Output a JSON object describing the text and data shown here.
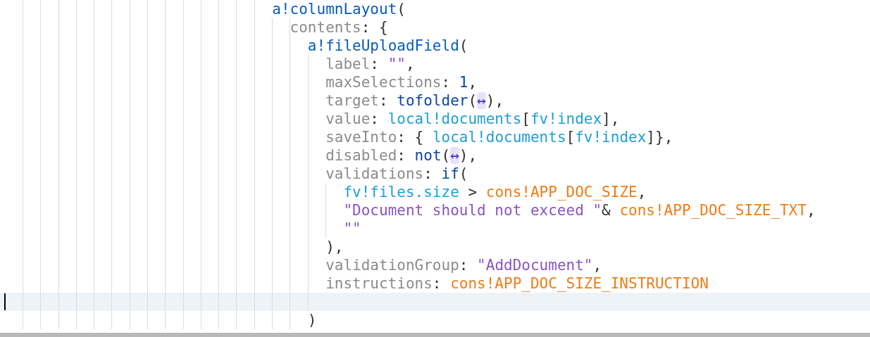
{
  "editor": {
    "lines": [
      {
        "current": false,
        "tokens": [
          {
            "text": "a!columnLayout",
            "kind": "function"
          },
          {
            "text": "(",
            "kind": "punct"
          }
        ],
        "children": [
          {
            "current": false,
            "tokens": [
              {
                "text": "contents",
                "kind": "property"
              },
              {
                "text": ": {",
                "kind": "punct"
              }
            ],
            "children": [
              {
                "current": false,
                "tokens": [
                  {
                    "text": "a!fileUploadField",
                    "kind": "function"
                  },
                  {
                    "text": "(",
                    "kind": "punct"
                  }
                ],
                "children": [
                  {
                    "current": false,
                    "tokens": [
                      {
                        "text": "label",
                        "kind": "property"
                      },
                      {
                        "text": ": ",
                        "kind": "punct"
                      },
                      {
                        "text": "\"\"",
                        "kind": "string"
                      },
                      {
                        "text": ",",
                        "kind": "punct"
                      }
                    ]
                  },
                  {
                    "current": false,
                    "tokens": [
                      {
                        "text": "maxSelections",
                        "kind": "property"
                      },
                      {
                        "text": ": ",
                        "kind": "punct"
                      },
                      {
                        "text": "1",
                        "kind": "keyword"
                      },
                      {
                        "text": ",",
                        "kind": "punct"
                      }
                    ]
                  },
                  {
                    "current": false,
                    "tokens": [
                      {
                        "text": "target",
                        "kind": "property"
                      },
                      {
                        "text": ": ",
                        "kind": "punct"
                      },
                      {
                        "text": "tofolder",
                        "kind": "keyword"
                      },
                      {
                        "text": "(",
                        "kind": "punct"
                      },
                      {
                        "text": "↔",
                        "kind": "chip"
                      },
                      {
                        "text": "),",
                        "kind": "punct"
                      }
                    ]
                  },
                  {
                    "current": false,
                    "tokens": [
                      {
                        "text": "value",
                        "kind": "property"
                      },
                      {
                        "text": ": ",
                        "kind": "punct"
                      },
                      {
                        "text": "local!documents",
                        "kind": "variable"
                      },
                      {
                        "text": "[",
                        "kind": "punct"
                      },
                      {
                        "text": "fv!index",
                        "kind": "variable"
                      },
                      {
                        "text": "],",
                        "kind": "punct"
                      }
                    ]
                  },
                  {
                    "current": false,
                    "tokens": [
                      {
                        "text": "saveInto",
                        "kind": "property"
                      },
                      {
                        "text": ": { ",
                        "kind": "punct"
                      },
                      {
                        "text": "local!documents",
                        "kind": "variable"
                      },
                      {
                        "text": "[",
                        "kind": "punct"
                      },
                      {
                        "text": "fv!index",
                        "kind": "variable"
                      },
                      {
                        "text": "]},",
                        "kind": "punct"
                      }
                    ]
                  },
                  {
                    "current": false,
                    "tokens": [
                      {
                        "text": "disabled",
                        "kind": "property"
                      },
                      {
                        "text": ": ",
                        "kind": "punct"
                      },
                      {
                        "text": "not",
                        "kind": "keyword"
                      },
                      {
                        "text": "(",
                        "kind": "punct"
                      },
                      {
                        "text": "↔",
                        "kind": "chip"
                      },
                      {
                        "text": "),",
                        "kind": "punct"
                      }
                    ]
                  },
                  {
                    "current": false,
                    "tokens": [
                      {
                        "text": "validations",
                        "kind": "property"
                      },
                      {
                        "text": ": ",
                        "kind": "punct"
                      },
                      {
                        "text": "if",
                        "kind": "keyword"
                      },
                      {
                        "text": "(",
                        "kind": "punct"
                      }
                    ],
                    "children": [
                      {
                        "current": false,
                        "tokens": [
                          {
                            "text": "fv!files.size",
                            "kind": "variable"
                          },
                          {
                            "text": " > ",
                            "kind": "punct"
                          },
                          {
                            "text": "cons!APP_DOC_SIZE",
                            "kind": "constant"
                          },
                          {
                            "text": ",",
                            "kind": "punct"
                          }
                        ]
                      },
                      {
                        "current": false,
                        "tokens": [
                          {
                            "text": "\"Document should not exceed \"",
                            "kind": "string"
                          },
                          {
                            "text": "& ",
                            "kind": "punct"
                          },
                          {
                            "text": "cons!APP_DOC_SIZE_TXT",
                            "kind": "constant"
                          },
                          {
                            "text": ",",
                            "kind": "punct"
                          }
                        ]
                      },
                      {
                        "current": false,
                        "tokens": [
                          {
                            "text": "\"\"",
                            "kind": "string"
                          }
                        ]
                      }
                    ]
                  },
                  {
                    "current": false,
                    "tokens": [
                      {
                        "text": "),",
                        "kind": "punct"
                      }
                    ]
                  },
                  {
                    "current": false,
                    "tokens": [
                      {
                        "text": "validationGroup",
                        "kind": "property"
                      },
                      {
                        "text": ": ",
                        "kind": "punct"
                      },
                      {
                        "text": "\"AddDocument\"",
                        "kind": "string"
                      },
                      {
                        "text": ",",
                        "kind": "punct"
                      }
                    ]
                  },
                  {
                    "current": false,
                    "tokens": [
                      {
                        "text": "instructions",
                        "kind": "property"
                      },
                      {
                        "text": ": ",
                        "kind": "punct"
                      },
                      {
                        "text": "cons!APP_DOC_SIZE_INSTRUCTION",
                        "kind": "constant"
                      }
                    ]
                  },
                  {
                    "current": true
                  }
                ]
              },
              {
                "current": false,
                "tokens": [
                  {
                    "text": ")",
                    "kind": "punct"
                  }
                ]
              }
            ]
          }
        ]
      }
    ]
  }
}
